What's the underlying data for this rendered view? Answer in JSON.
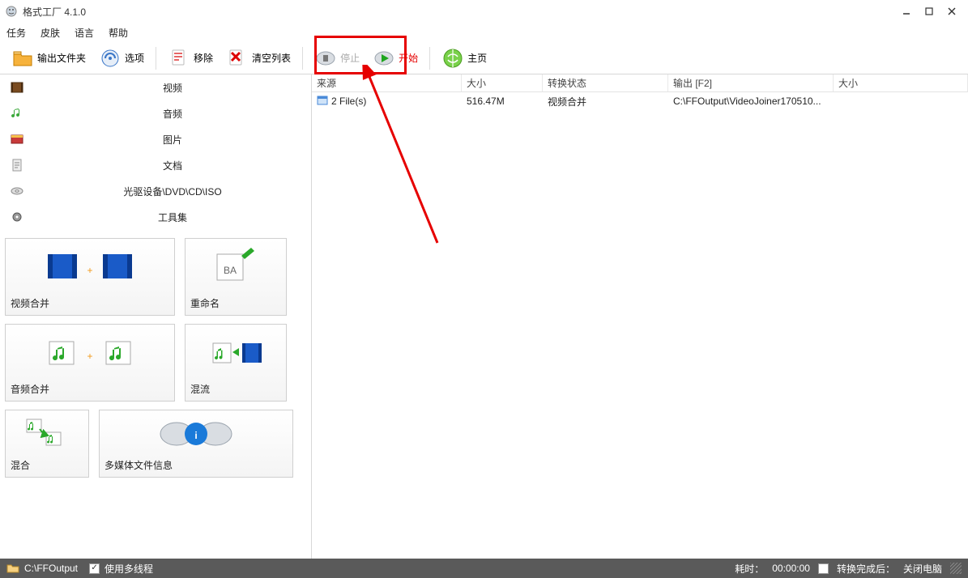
{
  "title": "格式工厂 4.1.0",
  "menu": {
    "task": "任务",
    "skin": "皮肤",
    "lang": "语言",
    "help": "帮助"
  },
  "toolbar": {
    "output_folder": "输出文件夹",
    "options": "选项",
    "remove": "移除",
    "clear_list": "清空列表",
    "stop": "停止",
    "start": "开始",
    "home": "主页"
  },
  "categories": {
    "video": "视频",
    "audio": "音频",
    "image": "图片",
    "doc": "文档",
    "disc": "光驱设备\\DVD\\CD\\ISO",
    "tools": "工具集"
  },
  "tiles": {
    "video_join": "视频合并",
    "rename": "重命名",
    "audio_join": "音频合并",
    "mux": "混流",
    "mix": "混合",
    "media_info": "多媒体文件信息"
  },
  "list": {
    "headers": {
      "source": "来源",
      "size": "大小",
      "state": "转换状态",
      "output": "输出 [F2]",
      "size2": "大小"
    },
    "rows": [
      {
        "source": "2 File(s)",
        "size": "516.47M",
        "state": "视频合并",
        "output": "C:\\FFOutput\\VideoJoiner170510...",
        "size2": ""
      }
    ]
  },
  "status": {
    "path": "C:\\FFOutput",
    "multithread": "使用多线程",
    "elapsed_label": "耗时：",
    "elapsed_value": "00:00:00",
    "after_label": "转换完成后：",
    "after_value": "关闭电脑"
  }
}
